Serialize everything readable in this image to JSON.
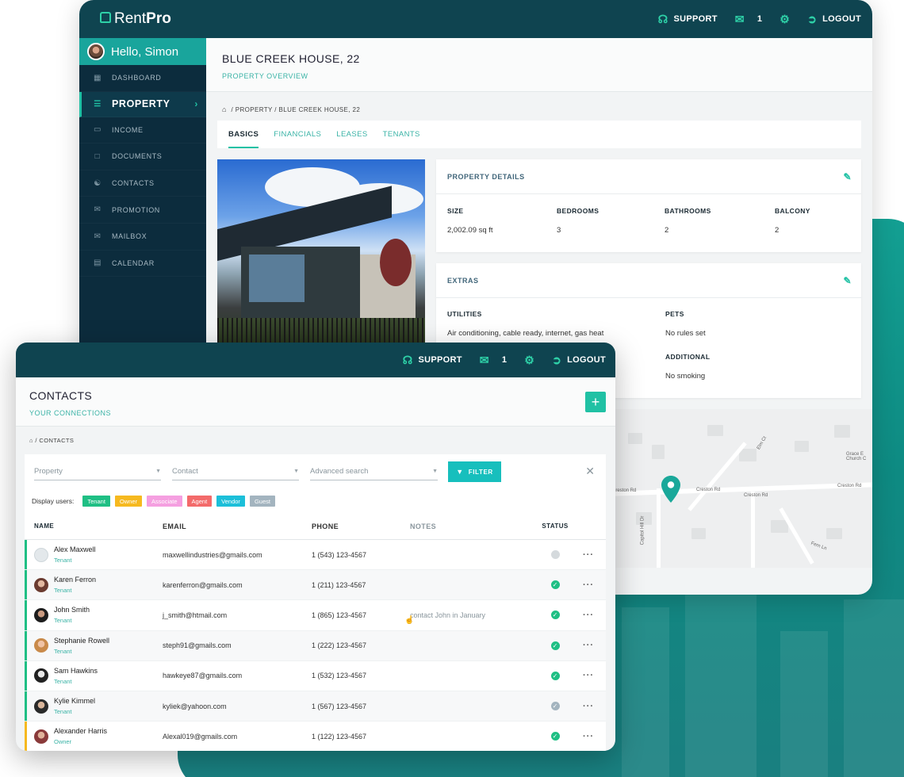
{
  "colors": {
    "topbar": "#0f4450",
    "accent": "#20c1a4",
    "sidebar": "#0c2c3d",
    "hello_bg": "#19a59c"
  },
  "main": {
    "logo": {
      "light": "Rent",
      "bold": "Pro"
    },
    "topbar": {
      "support": "SUPPORT",
      "mail_count": "1",
      "logout": "LOGOUT"
    },
    "hello": "Hello, Simon",
    "nav": [
      {
        "label": "DASHBOARD",
        "icon": "dashboard-icon"
      },
      {
        "label": "PROPERTY",
        "icon": "list-icon"
      },
      {
        "label": "INCOME",
        "icon": "card-icon"
      },
      {
        "label": "DOCUMENTS",
        "icon": "document-icon"
      },
      {
        "label": "CONTACTS",
        "icon": "contacts-icon"
      },
      {
        "label": "PROMOTION",
        "icon": "megaphone-icon"
      },
      {
        "label": "MAILBOX",
        "icon": "mail-icon"
      },
      {
        "label": "CALENDAR",
        "icon": "calendar-icon"
      }
    ],
    "page_title": "BLUE CREEK HOUSE, 22",
    "page_subtitle": "PROPERTY OVERVIEW",
    "breadcrumb": {
      "level1": "PROPERTY",
      "level2": "BLUE CREEK HOUSE, 22"
    },
    "tabs": [
      "BASICS",
      "FINANCIALS",
      "LEASES",
      "TENANTS"
    ],
    "details": {
      "title": "PROPERTY DETAILS",
      "fields": [
        {
          "label": "SIZE",
          "value": "2,002.09 sq ft"
        },
        {
          "label": "BEDROOMS",
          "value": "3"
        },
        {
          "label": "BATHROOMS",
          "value": "2"
        },
        {
          "label": "BALCONY",
          "value": "2"
        }
      ]
    },
    "extras": {
      "title": "EXTRAS",
      "utilities_label": "UTILITIES",
      "utilities_value": "Air conditioning, cable ready, internet, gas heat",
      "pets_label": "PETS",
      "pets_value": "No rules set",
      "additional_label": "ADDITIONAL",
      "additional_value": "No smoking"
    },
    "map_labels": [
      "Creston Rd",
      "Creston Rd",
      "Creston Rd",
      "Creston Rd",
      "Capitol Hill Dr",
      "Elm Ct",
      "Fern Ln",
      "Grace E Church C"
    ]
  },
  "contacts": {
    "topbar": {
      "support": "SUPPORT",
      "mail_count": "1",
      "logout": "LOGOUT"
    },
    "title": "CONTACTS",
    "subtitle": "YOUR CONNECTIONS",
    "breadcrumb": "CONTACTS",
    "filters": {
      "property": "Property",
      "contact": "Contact",
      "advanced": "Advanced search",
      "button": "FILTER"
    },
    "display_label": "Display users:",
    "chips": [
      {
        "label": "Tenant",
        "color": "#1fbf84"
      },
      {
        "label": "Owner",
        "color": "#f6b91f"
      },
      {
        "label": "Associate",
        "color": "#f59fe0"
      },
      {
        "label": "Agent",
        "color": "#f36a6a"
      },
      {
        "label": "Vendor",
        "color": "#1cbfd9"
      },
      {
        "label": "Guest",
        "color": "#a3b4bf"
      }
    ],
    "columns": {
      "name": "NAME",
      "email": "EMAIL",
      "phone": "PHONE",
      "notes": "NOTES",
      "status": "STATUS"
    },
    "rows": [
      {
        "name": "Alex Maxwell",
        "role": "Tenant",
        "email": "maxwellindustries@gmails.com",
        "phone": "1 (543) 123-4567",
        "notes": "",
        "status": "inactive"
      },
      {
        "name": "Karen Ferron",
        "role": "Tenant",
        "email": "karenferron@gmails.com",
        "phone": "1 (211) 123-4567",
        "notes": "",
        "status": "active"
      },
      {
        "name": "John Smith",
        "role": "Tenant",
        "email": "j_smith@htmail.com",
        "phone": "1 (865) 123-4567",
        "notes": "contact John in January",
        "status": "active"
      },
      {
        "name": "Stephanie Rowell",
        "role": "Tenant",
        "email": "steph91@gmails.com",
        "phone": "1 (222) 123-4567",
        "notes": "",
        "status": "active"
      },
      {
        "name": "Sam Hawkins",
        "role": "Tenant",
        "email": "hawkeye87@gmails.com",
        "phone": "1 (532) 123-4567",
        "notes": "",
        "status": "active"
      },
      {
        "name": "Kylie Kimmel",
        "role": "Tenant",
        "email": "kyliek@yahoon.com",
        "phone": "1 (567) 123-4567",
        "notes": "",
        "status": "pending"
      },
      {
        "name": "Alexander Harris",
        "role": "Owner",
        "email": "Alexal019@gmails.com",
        "phone": "1 (122) 123-4567",
        "notes": "",
        "status": "active"
      }
    ]
  }
}
